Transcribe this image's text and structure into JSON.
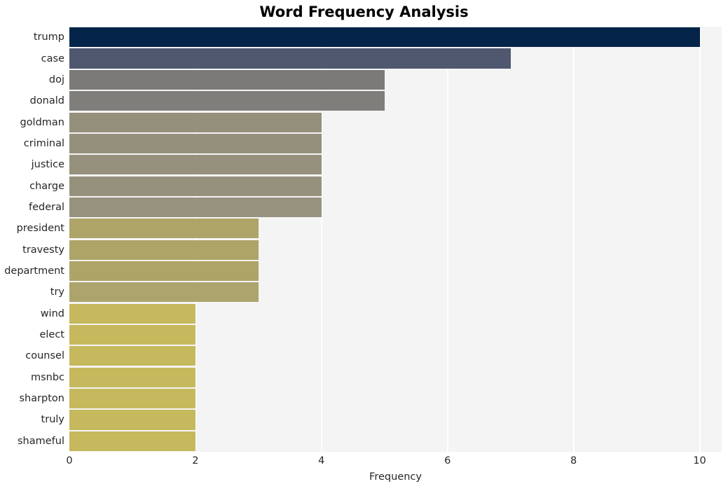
{
  "chart_data": {
    "type": "bar",
    "orientation": "horizontal",
    "title": "Word Frequency Analysis",
    "xlabel": "Frequency",
    "ylabel": "",
    "xlim": [
      0,
      10.35
    ],
    "xticks": [
      0,
      2,
      4,
      6,
      8,
      10
    ],
    "xtick_labels": [
      "0",
      "2",
      "4",
      "6",
      "8",
      "10"
    ],
    "grid": "vertical-white-on-gray",
    "legend": "none",
    "background": "#f4f4f5",
    "categories": [
      "trump",
      "case",
      "doj",
      "donald",
      "goldman",
      "criminal",
      "justice",
      "charge",
      "federal",
      "president",
      "travesty",
      "department",
      "try",
      "wind",
      "elect",
      "counsel",
      "msnbc",
      "sharpton",
      "truly",
      "shameful"
    ],
    "values": [
      10,
      7,
      5,
      5,
      4,
      4,
      4,
      4,
      4,
      3,
      3,
      3,
      3,
      2,
      2,
      2,
      2,
      2,
      2,
      2
    ],
    "colors": [
      "#042449",
      "#4f586f",
      "#7b7a78",
      "#7f7e7b",
      "#95907c",
      "#95907c",
      "#96917d",
      "#96917d",
      "#97927e",
      "#aea468",
      "#aea468",
      "#aea468",
      "#aca46c",
      "#c6b85c",
      "#c6b85c",
      "#c6b85c",
      "#c6b85c",
      "#c6b85c",
      "#c6b85c",
      "#c6b85c"
    ]
  }
}
